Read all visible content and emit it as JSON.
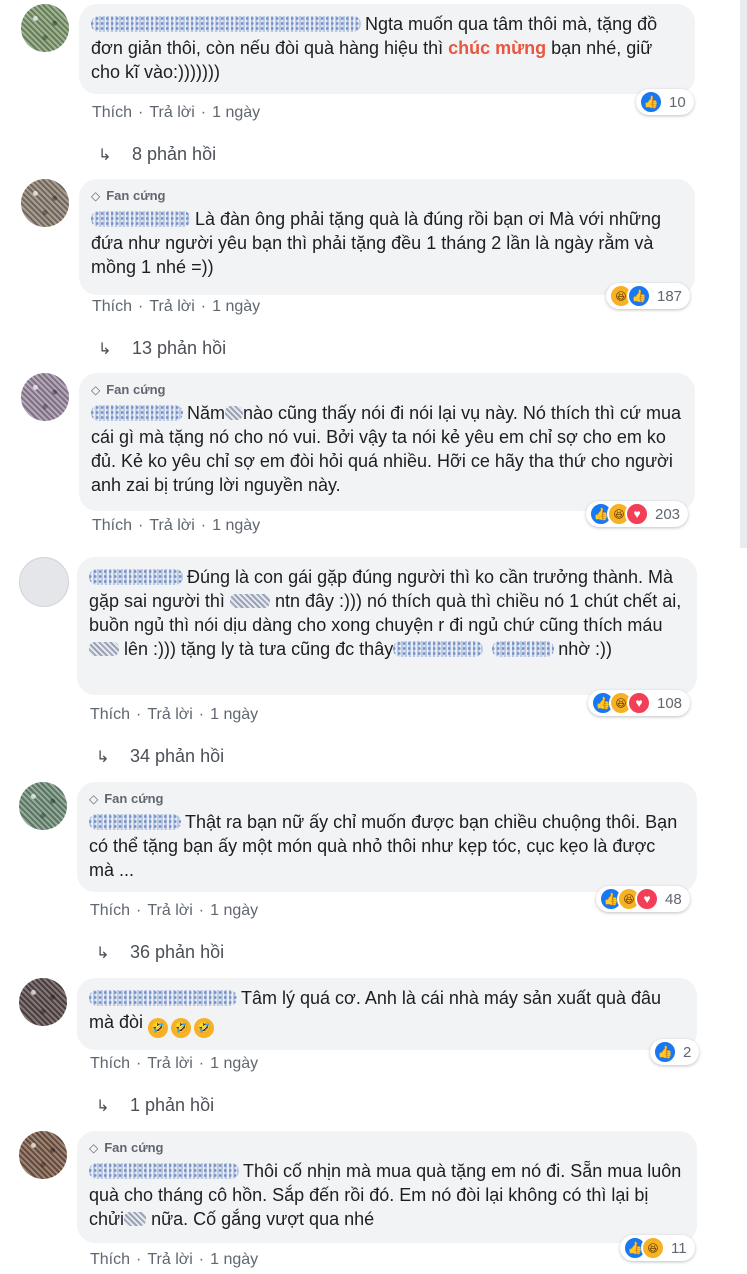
{
  "actions": {
    "like": "Thích",
    "reply": "Trả lời",
    "sep": "·"
  },
  "badge": "Fan cứng",
  "comments": [
    {
      "text_before": "Ngta muốn qua tâm thôi mà, tặng đồ đơn giản thôi, còn nếu đòi quà hàng hiệu thì ",
      "highlight": "chúc mừng",
      "text_after": " bạn nhé, giữ cho kĩ vào:)))))))",
      "time": "1 ngày",
      "reaction_count": "10",
      "replies": "8 phản hồi"
    },
    {
      "text": "Là đàn ông phải tặng quà là đúng rồi bạn ơi Mà với những đứa như người yêu bạn thì phải tặng đều 1 tháng 2 lần là ngày rằm và mồng 1 nhé =))",
      "time": "1 ngày",
      "reaction_count": "187",
      "replies": "13 phản hồi"
    },
    {
      "text_a": "Năm",
      "text_b": "nào cũng thấy nói đi nói lại vụ này. Nó thích thì cứ mua cái gì mà tặng nó cho nó vui. Bởi vậy ta nói kẻ yêu em chỉ sợ cho em ko đủ. Kẻ ko yêu chỉ sợ em đòi hỏi quá nhiều. Hỡi ce hãy tha thứ cho người anh zai bị trúng lời nguyền này.",
      "time": "1 ngày",
      "reaction_count": "203"
    },
    {
      "text_a": "Đúng là con gái gặp đúng người thì ko cần trưởng thành. Mà gặp sai người thì",
      "text_b": "ntn đây :))) nó thích quà thì chiều nó 1 chút chết ai, buồn ngủ thì nói dịu dàng cho xong chuyện r đi ngủ chứ cũng thích máu",
      "text_c": "lên :))) tặng ly tà tưa cũng đc thây",
      "text_d": "nhờ :))",
      "time": "1 ngày",
      "reaction_count": "108",
      "replies": "34 phản hồi"
    },
    {
      "text": "Thật ra bạn nữ ấy chỉ muốn được bạn chiều chuộng thôi. Bạn có thể tặng bạn ấy một món quà nhỏ thôi như kẹp tóc, cục kẹo là được mà ...",
      "time": "1 ngày",
      "reaction_count": "48",
      "replies": "36 phản hồi"
    },
    {
      "text": "Tâm lý quá cơ. Anh là cái nhà máy sản xuất quà đâu mà đòi",
      "time": "1 ngày",
      "reaction_count": "2",
      "replies": "1 phản hồi"
    },
    {
      "text_a": "Thôi cố nhịn mà mua quà tặng em nó đi. Sẵn mua luôn quà cho tháng cô hồn. Sắp đến rồi đó. Em nó đòi lại không có thì lại bị chửi",
      "text_b": "nữa. Cố gắng vượt qua nhé",
      "time": "1 ngày",
      "reaction_count": "11"
    }
  ]
}
